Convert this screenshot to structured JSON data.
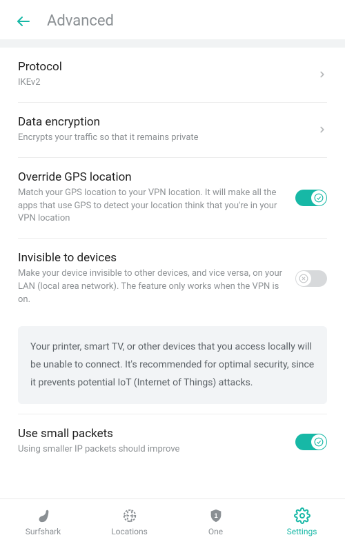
{
  "header": {
    "title": "Advanced"
  },
  "rows": {
    "protocol": {
      "title": "Protocol",
      "sub": "IKEv2"
    },
    "encryption": {
      "title": "Data encryption",
      "sub": "Encrypts your traffic so that it remains private"
    },
    "gps": {
      "title": "Override GPS location",
      "sub": "Match your GPS location to your VPN location. It will make all the apps that use GPS to detect your location think that you're in your VPN location",
      "enabled": true
    },
    "invisible": {
      "title": "Invisible to devices",
      "sub": "Make your device invisible to other devices, and vice versa, on your LAN (local area network). The feature only works when the VPN is on.",
      "enabled": false,
      "info": "Your printer, smart TV, or other devices that you access locally will be unable to connect. It's recommended for optimal security, since it prevents potential IoT (Internet of Things) attacks."
    },
    "smallpackets": {
      "title": "Use small packets",
      "sub": "Using smaller IP packets should improve",
      "enabled": true
    }
  },
  "tabs": {
    "surfshark": "Surfshark",
    "locations": "Locations",
    "one": "One",
    "settings": "Settings",
    "active": "settings"
  }
}
